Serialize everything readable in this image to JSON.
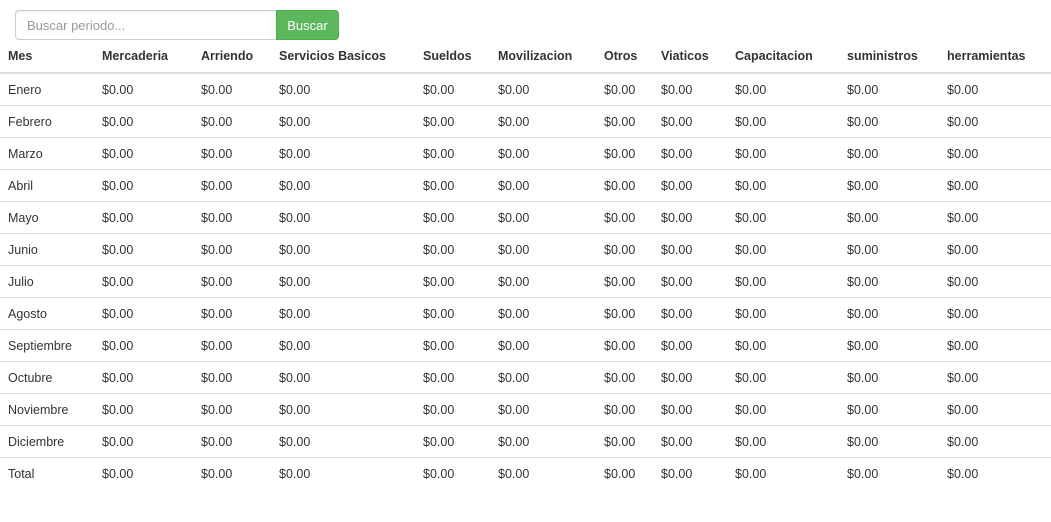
{
  "search": {
    "placeholder": "Buscar periodo...",
    "value": "",
    "button_label": "Buscar"
  },
  "table": {
    "headers": [
      "Mes",
      "Mercaderia",
      "Arriendo",
      "Servicios Basicos",
      "Sueldos",
      "Movilizacion",
      "Otros",
      "Viaticos",
      "Capacitacion",
      "suministros",
      "herramientas"
    ],
    "rows": [
      [
        "Enero",
        "$0.00",
        "$0.00",
        "$0.00",
        "$0.00",
        "$0.00",
        "$0.00",
        "$0.00",
        "$0.00",
        "$0.00",
        "$0.00"
      ],
      [
        "Febrero",
        "$0.00",
        "$0.00",
        "$0.00",
        "$0.00",
        "$0.00",
        "$0.00",
        "$0.00",
        "$0.00",
        "$0.00",
        "$0.00"
      ],
      [
        "Marzo",
        "$0.00",
        "$0.00",
        "$0.00",
        "$0.00",
        "$0.00",
        "$0.00",
        "$0.00",
        "$0.00",
        "$0.00",
        "$0.00"
      ],
      [
        "Abril",
        "$0.00",
        "$0.00",
        "$0.00",
        "$0.00",
        "$0.00",
        "$0.00",
        "$0.00",
        "$0.00",
        "$0.00",
        "$0.00"
      ],
      [
        "Mayo",
        "$0.00",
        "$0.00",
        "$0.00",
        "$0.00",
        "$0.00",
        "$0.00",
        "$0.00",
        "$0.00",
        "$0.00",
        "$0.00"
      ],
      [
        "Junio",
        "$0.00",
        "$0.00",
        "$0.00",
        "$0.00",
        "$0.00",
        "$0.00",
        "$0.00",
        "$0.00",
        "$0.00",
        "$0.00"
      ],
      [
        "Julio",
        "$0.00",
        "$0.00",
        "$0.00",
        "$0.00",
        "$0.00",
        "$0.00",
        "$0.00",
        "$0.00",
        "$0.00",
        "$0.00"
      ],
      [
        "Agosto",
        "$0.00",
        "$0.00",
        "$0.00",
        "$0.00",
        "$0.00",
        "$0.00",
        "$0.00",
        "$0.00",
        "$0.00",
        "$0.00"
      ],
      [
        "Septiembre",
        "$0.00",
        "$0.00",
        "$0.00",
        "$0.00",
        "$0.00",
        "$0.00",
        "$0.00",
        "$0.00",
        "$0.00",
        "$0.00"
      ],
      [
        "Octubre",
        "$0.00",
        "$0.00",
        "$0.00",
        "$0.00",
        "$0.00",
        "$0.00",
        "$0.00",
        "$0.00",
        "$0.00",
        "$0.00"
      ],
      [
        "Noviembre",
        "$0.00",
        "$0.00",
        "$0.00",
        "$0.00",
        "$0.00",
        "$0.00",
        "$0.00",
        "$0.00",
        "$0.00",
        "$0.00"
      ],
      [
        "Diciembre",
        "$0.00",
        "$0.00",
        "$0.00",
        "$0.00",
        "$0.00",
        "$0.00",
        "$0.00",
        "$0.00",
        "$0.00",
        "$0.00"
      ],
      [
        "Total",
        "$0.00",
        "$0.00",
        "$0.00",
        "$0.00",
        "$0.00",
        "$0.00",
        "$0.00",
        "$0.00",
        "$0.00",
        "$0.00"
      ]
    ]
  },
  "colors": {
    "button_bg": "#5cb85c",
    "button_border": "#4cae4c",
    "row_border": "#dddddd",
    "text": "#333333"
  }
}
